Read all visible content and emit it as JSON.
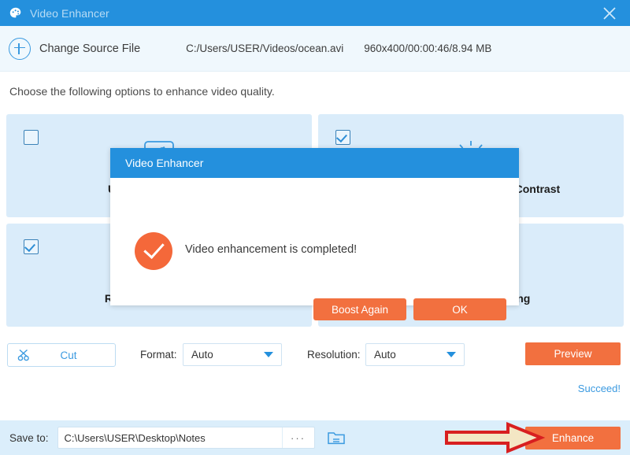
{
  "titlebar": {
    "title": "Video Enhancer",
    "app_icon": "palette-icon",
    "close_icon": "close-icon",
    "accent_color": "#2490dd"
  },
  "sourcebar": {
    "add_icon": "plus-circle-icon",
    "change_source_label": "Change Source File",
    "source_path": "C:/Users/USER/Videos/ocean.avi",
    "source_meta": "960x400/00:00:46/8.94 MB"
  },
  "main": {
    "instruction": "Choose the following options to enhance video quality.",
    "options": [
      {
        "label": "Upscale Resolution",
        "icon": "upscale-icon",
        "checked": false
      },
      {
        "label": "Optimize Brightness and Contrast",
        "icon": "brightness-sun-icon",
        "checked": true
      },
      {
        "label": "Remove Video Noise",
        "icon": "denoise-icon",
        "checked": true
      },
      {
        "label": "Reduce Video Shaking",
        "icon": "stabilize-icon",
        "checked": true
      }
    ]
  },
  "tools": {
    "cut_label": "Cut",
    "cut_icon": "scissors-icon",
    "format_label": "Format:",
    "format_value": "Auto",
    "resolution_label": "Resolution:",
    "resolution_value": "Auto",
    "preview_label": "Preview",
    "status_link": "Succeed!",
    "caret_icon": "chevron-down-icon"
  },
  "savebar": {
    "save_label": "Save to:",
    "save_path": "C:\\Users\\USER\\Desktop\\Notes",
    "browse_label": "···",
    "folder_icon": "folder-open-icon",
    "enhance_label": "Enhance",
    "arrow_annotation": "red-arrow-pointing-to-enhance"
  },
  "dialog": {
    "title": "Video Enhancer",
    "status_icon": "success-check-icon",
    "message": "Video enhancement is completed!",
    "boost_label": "Boost Again",
    "ok_label": "OK",
    "button_color": "#f2703f"
  }
}
